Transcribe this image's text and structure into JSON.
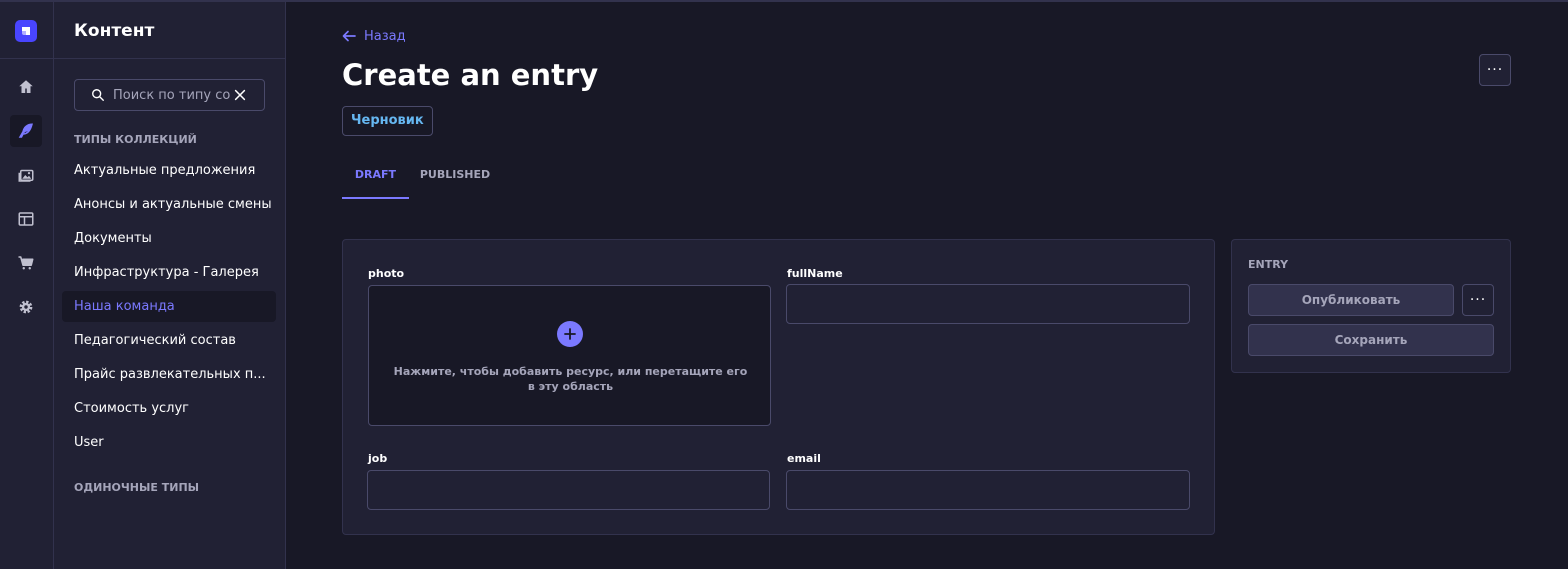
{
  "colors": {
    "accent": "#7b79ff",
    "brand": "#4945ff",
    "status_draft": "#66b7f1",
    "background": "#181826",
    "surface": "#212134"
  },
  "rail": {
    "logo_icon": "strapi-logo-icon",
    "items": [
      {
        "icon": "home-icon"
      },
      {
        "icon": "feather-icon",
        "active": true
      },
      {
        "icon": "media-library-icon"
      },
      {
        "icon": "layout-icon"
      },
      {
        "icon": "cart-icon"
      },
      {
        "icon": "gear-icon"
      }
    ]
  },
  "subnav": {
    "title": "Контент",
    "search_placeholder": "Поиск по типу содержимого",
    "collection_types_label": "ТИПЫ КОЛЛЕКЦИЙ",
    "items": [
      {
        "label": "Актуальные предложения"
      },
      {
        "label": "Анонсы и актуальные смены"
      },
      {
        "label": "Документы"
      },
      {
        "label": "Инфраструктура - Галерея"
      },
      {
        "label": "Наша команда",
        "active": true
      },
      {
        "label": "Педагогический состав"
      },
      {
        "label": "Прайс развлекательных п..."
      },
      {
        "label": "Стоимость услуг"
      },
      {
        "label": "User"
      }
    ],
    "single_types_label": "ОДИНОЧНЫЕ ТИПЫ"
  },
  "header": {
    "back_label": "Назад",
    "title": "Create an entry",
    "status": "Черновик",
    "more_label": "···"
  },
  "tabs": [
    {
      "label": "DRAFT",
      "active": true
    },
    {
      "label": "PUBLISHED",
      "active": false
    }
  ],
  "form": {
    "photo_label": "photo",
    "dropzone_text": "Нажмите, чтобы добавить ресурс, или перетащите его в эту область",
    "fullname_label": "fullName",
    "fullname_value": "",
    "job_label": "job",
    "job_value": "",
    "email_label": "email",
    "email_value": ""
  },
  "entry_panel": {
    "label": "ENTRY",
    "publish_label": "Опубликовать",
    "more_label": "···",
    "save_label": "Сохранить"
  }
}
